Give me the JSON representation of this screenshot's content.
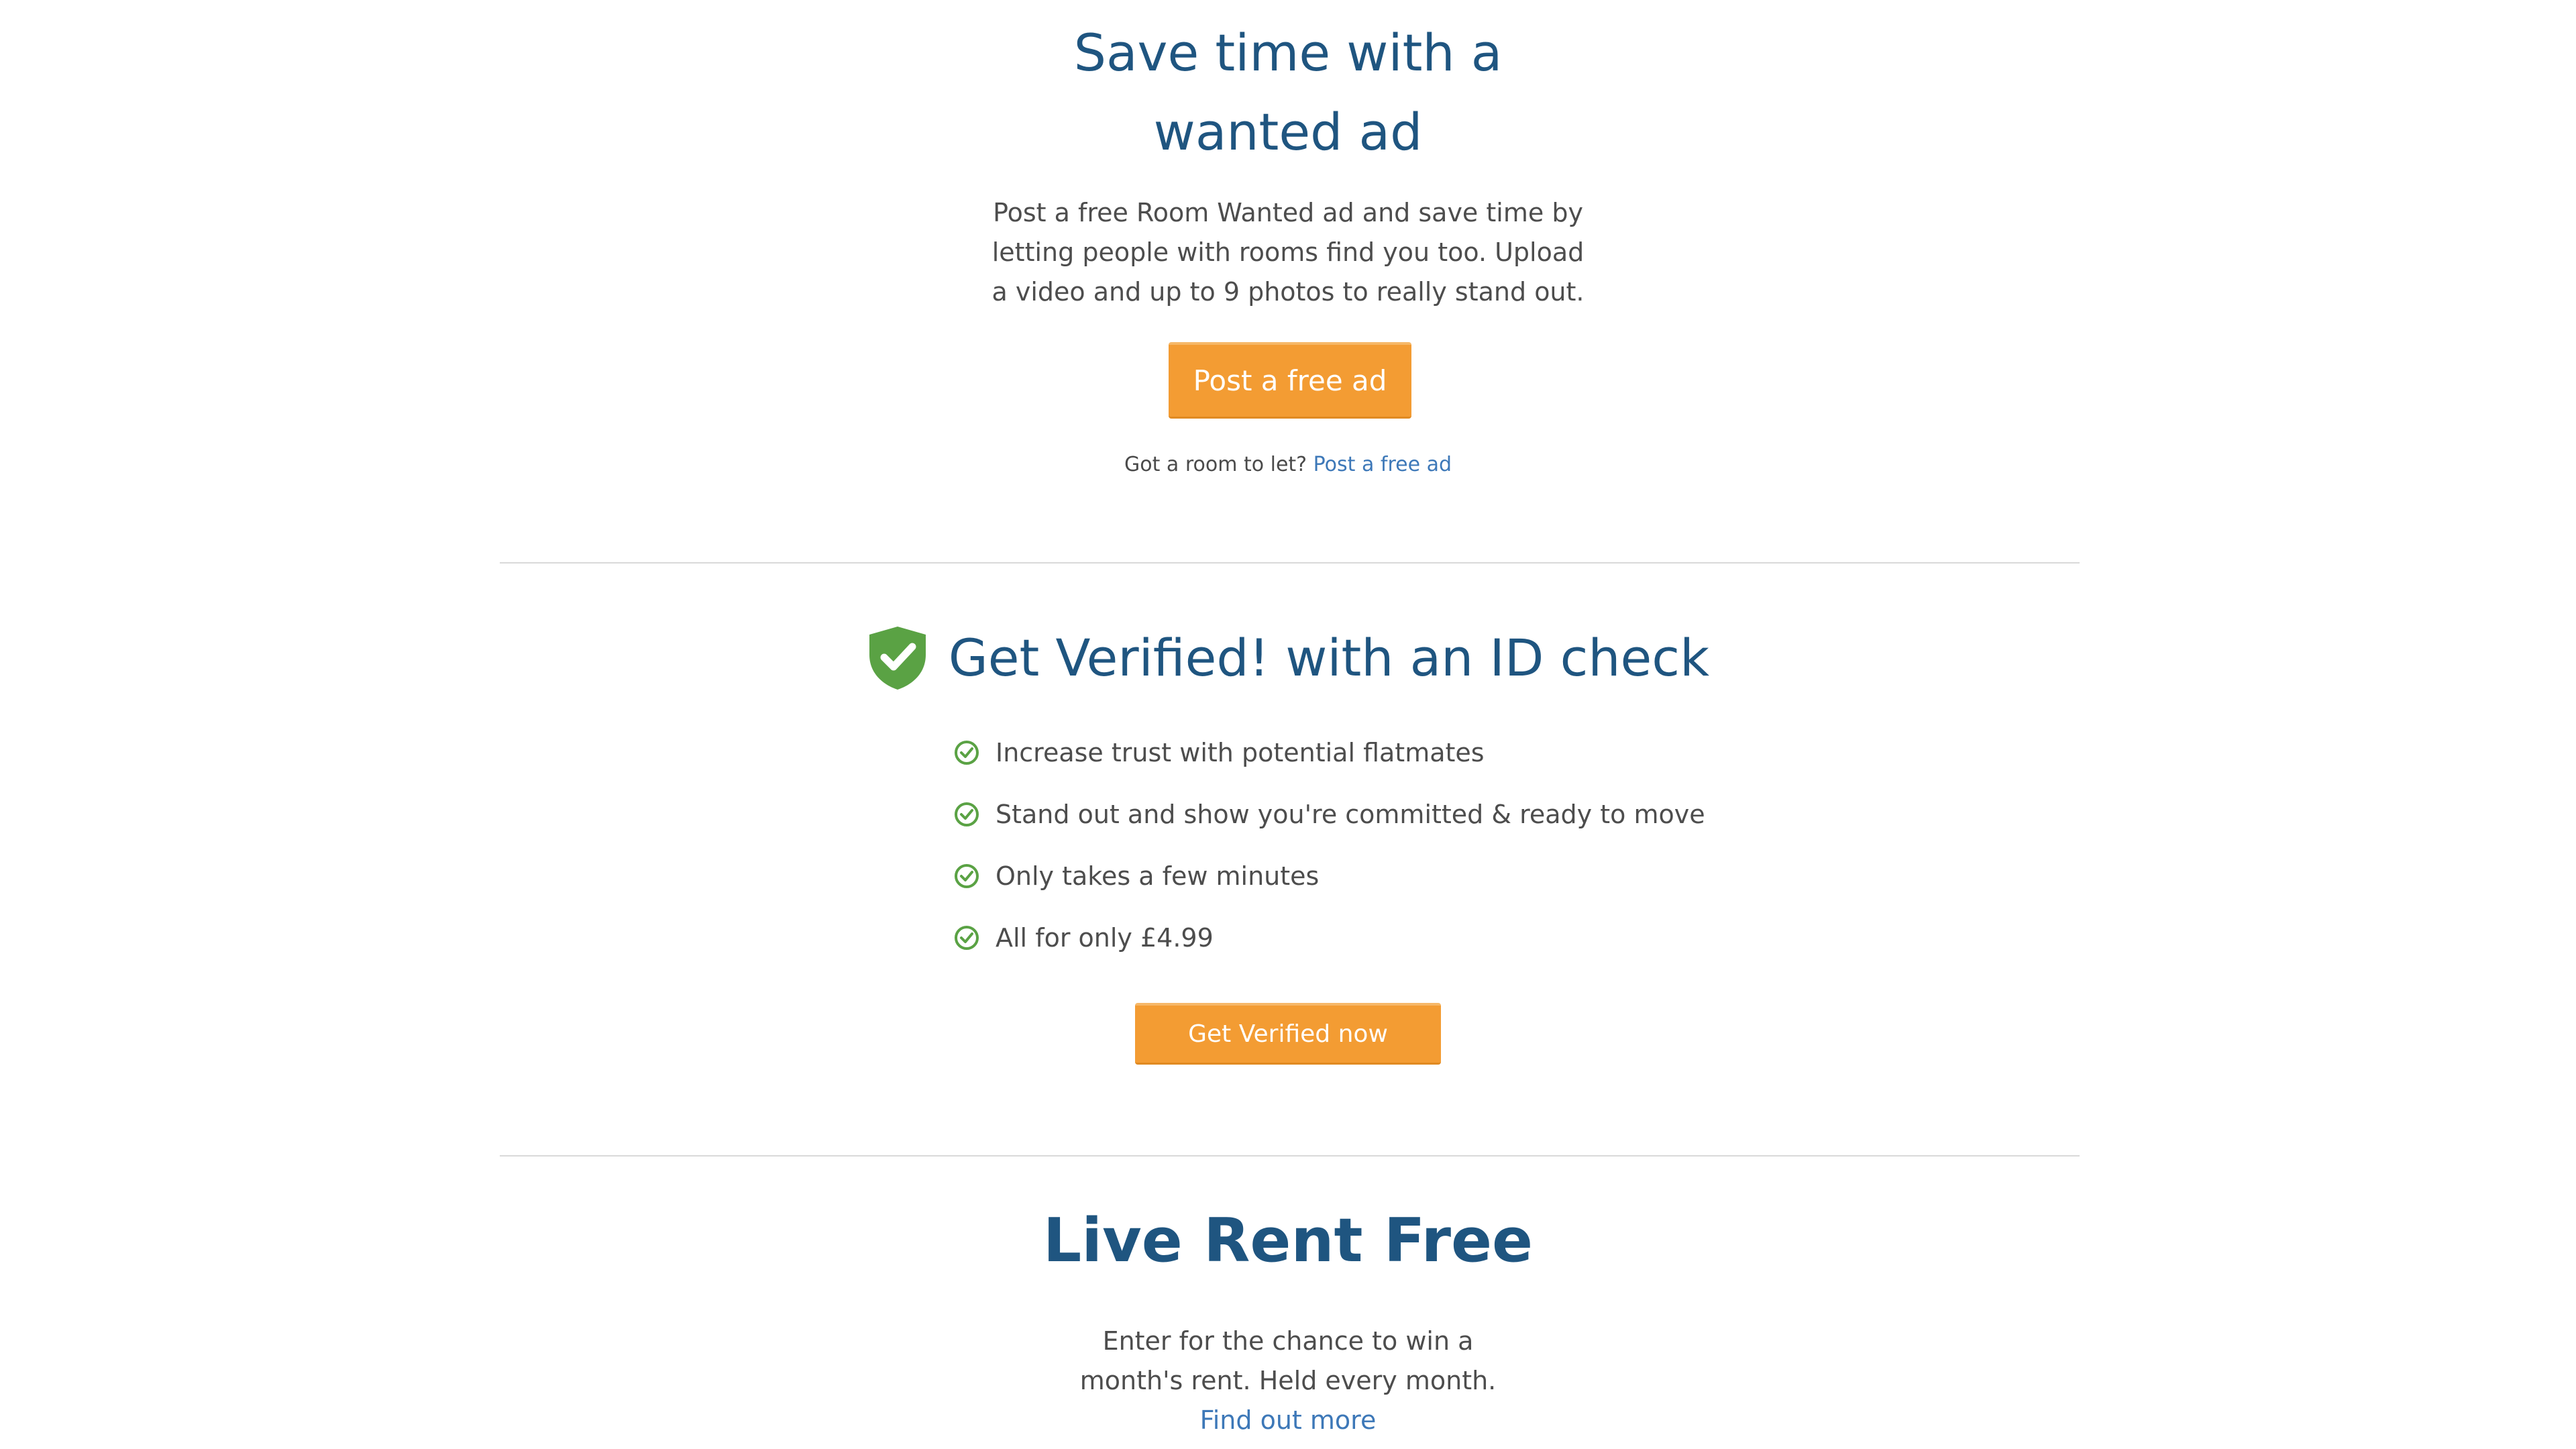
{
  "wanted_ad": {
    "title_line1": "Save time with a",
    "title_line2": "wanted ad",
    "desc_line1": "Post a free Room Wanted ad and save time by",
    "desc_line2": "letting people with rooms find you too. Upload",
    "desc_line3": "a video and up to 9 photos to really stand out.",
    "button_label": "Post a free ad",
    "note_text": "Got a room to let?",
    "note_link": "Post a free ad"
  },
  "verified": {
    "title": "Get Verified! with an ID check",
    "benefits": [
      "Increase trust with potential flatmates",
      "Stand out and show you're committed & ready to move",
      "Only takes a few minutes",
      "All for only £4.99"
    ],
    "button_label": "Get Verified now"
  },
  "rent_free": {
    "title": "Live Rent Free",
    "desc_line1": "Enter for the chance to win a",
    "desc_line2": "month's rent. Held every month.",
    "link_label": "Find out more"
  },
  "colors": {
    "heading": "#1f5580",
    "button": "#f39c33",
    "link": "#3d78b8",
    "check_green": "#5aa244"
  },
  "icons": {
    "verified_badge": "shield-check-icon",
    "benefit_check": "check-circle-icon"
  }
}
